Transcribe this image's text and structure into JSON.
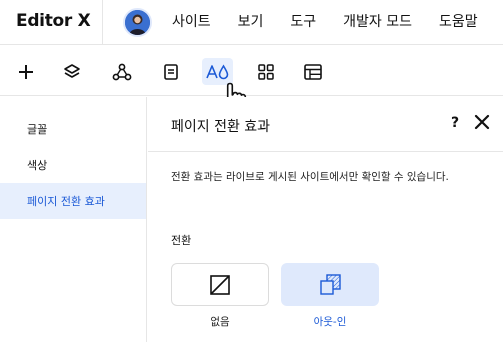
{
  "app": {
    "logo": "Editor X"
  },
  "menu": [
    "사이트",
    "보기",
    "도구",
    "개발자 모드",
    "도움말"
  ],
  "toolbar": {
    "items": [
      {
        "icon": "add-icon"
      },
      {
        "icon": "layers-icon"
      },
      {
        "icon": "connections-icon"
      },
      {
        "icon": "pages-icon"
      },
      {
        "icon": "theme-manager-icon",
        "active": true
      },
      {
        "icon": "apps-grid-icon"
      },
      {
        "icon": "table-icon"
      }
    ]
  },
  "sidebar": {
    "items": [
      {
        "label": "글꼴"
      },
      {
        "label": "색상"
      },
      {
        "label": "페이지 전환 효과",
        "active": true
      }
    ]
  },
  "panel": {
    "title": "페이지 전환 효과",
    "help": "?",
    "description": "전환 효과는 라이브로 게시된 사이트에서만 확인할 수 있습니다.",
    "section_label": "전환",
    "options": [
      {
        "label": "없음",
        "icon": "no-transition-icon",
        "selected": false
      },
      {
        "label": "아웃-인",
        "icon": "out-in-icon",
        "selected": true
      }
    ]
  },
  "colors": {
    "accent": "#1c5ad6",
    "active_bg": "#e7effd"
  }
}
